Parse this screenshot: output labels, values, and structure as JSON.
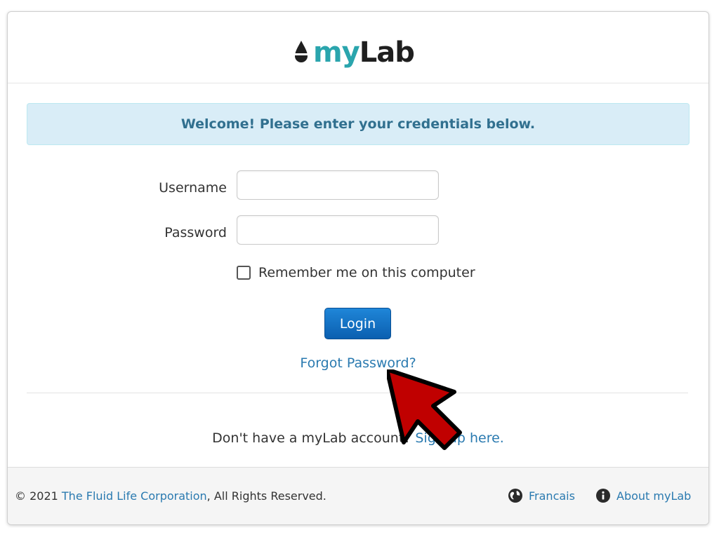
{
  "logo": {
    "my": "my",
    "lab": "Lab"
  },
  "alert": {
    "text": "Welcome! Please enter your credentials below."
  },
  "form": {
    "username_label": "Username",
    "username_value": "",
    "password_label": "Password",
    "password_value": "",
    "remember_label": "Remember me on this computer",
    "remember_checked": false,
    "login_label": "Login",
    "forgot_label": "Forgot Password?"
  },
  "signup": {
    "prompt": "Don't have a myLab account?",
    "link": "Sign up here."
  },
  "footer": {
    "copyright_prefix": "© 2021",
    "company_link": "The Fluid Life Corporation",
    "copyright_suffix": ", All Rights Reserved.",
    "language_link": "Francais",
    "about_link": "About myLab"
  },
  "colors": {
    "accent": "#2aa5ad",
    "link": "#2a7ab0",
    "primary_button": "#0b5fb0",
    "alert_bg": "#d9edf7",
    "alert_text": "#31708f",
    "cursor": "#c00000"
  },
  "icons": {
    "logo": "drop-icon",
    "language": "globe-icon",
    "about": "info-icon",
    "pointer": "arrow-cursor-icon"
  }
}
